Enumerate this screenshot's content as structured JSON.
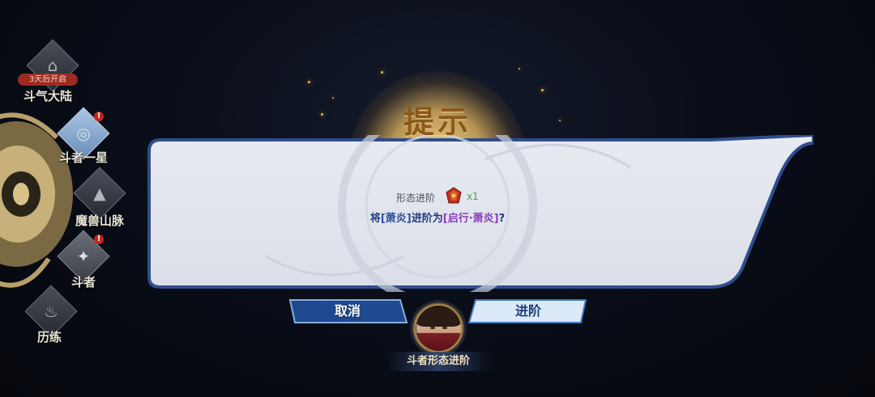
{
  "dialog": {
    "title": "提示",
    "form_label": "形态进阶",
    "item_icon": "red-gem-icon",
    "quantity": "x1",
    "question": {
      "prefix": "将",
      "name_current": "[萧炎]",
      "middle": "进阶为",
      "name_target": "[启行·萧炎]",
      "suffix": "?"
    },
    "cancel_label": "取消",
    "confirm_label": "进阶"
  },
  "avatar": {
    "caption": "斗者形态进阶"
  },
  "left_nav": {
    "items": [
      {
        "label": "斗气大陆",
        "icon": "temple-icon",
        "badge": "3天后开启"
      },
      {
        "label": "斗者一星",
        "icon": "swirl-icon",
        "alert": "!"
      },
      {
        "label": "魔兽山脉",
        "icon": "mountain-icon"
      },
      {
        "label": "斗者",
        "icon": "fighter-icon",
        "alert": "!"
      },
      {
        "label": "历练",
        "icon": "flame-icon"
      }
    ]
  },
  "colors": {
    "accent_blue": "#2f4f9e",
    "accent_purple": "#8b3fc0",
    "quantity_green": "#4d9f4f",
    "title_gold": "#8a5a1b"
  }
}
